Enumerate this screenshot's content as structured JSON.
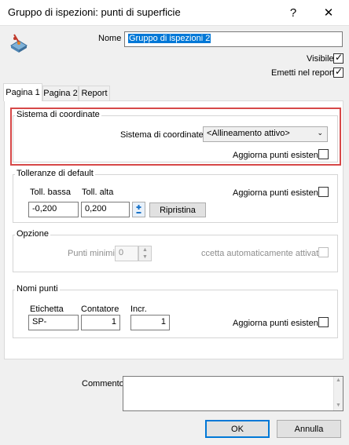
{
  "window": {
    "title": "Gruppo di ispezioni: punti di superficie",
    "help_glyph": "?",
    "close_glyph": "✕"
  },
  "header": {
    "name_label": "Nome",
    "name_value": "Gruppo di ispezioni 2",
    "visible_label": "Visibile",
    "visible_checked": true,
    "emit_label": "Emetti nel report",
    "emit_checked": true
  },
  "tabs": [
    {
      "label": "Pagina 1",
      "active": true
    },
    {
      "label": "Pagina 2",
      "active": false
    },
    {
      "label": "Report",
      "active": false
    }
  ],
  "coord_system": {
    "group_title": "Sistema di coordinate",
    "label": "Sistema di coordinate",
    "selected": "<Allineamento attivo>",
    "update_label": "Aggiorna punti esistenti",
    "highlight_color": "#d64848"
  },
  "tolerances": {
    "group_title": "Tolleranze di default",
    "low_label": "Toll. bassa",
    "high_label": "Toll. alta",
    "low_value": "-0,200",
    "high_value": "0,200",
    "reset_label": "Ripristina",
    "update_label": "Aggiorna punti esistenti"
  },
  "options": {
    "group_title": "Opzione",
    "min_points_label": "Punti minimi",
    "min_points_value": "0",
    "auto_accept_label": "ccetta automaticamente attivato"
  },
  "point_names": {
    "group_title": "Nomi punti",
    "label_header": "Etichetta",
    "counter_header": "Contatore",
    "incr_header": "Incr.",
    "label_value": "SP-",
    "counter_value": "1",
    "incr_value": "1",
    "update_label": "Aggiorna punti esistenti"
  },
  "footer": {
    "comment_label": "Commento",
    "comment_value": "",
    "ok_label": "OK",
    "cancel_label": "Annulla"
  }
}
